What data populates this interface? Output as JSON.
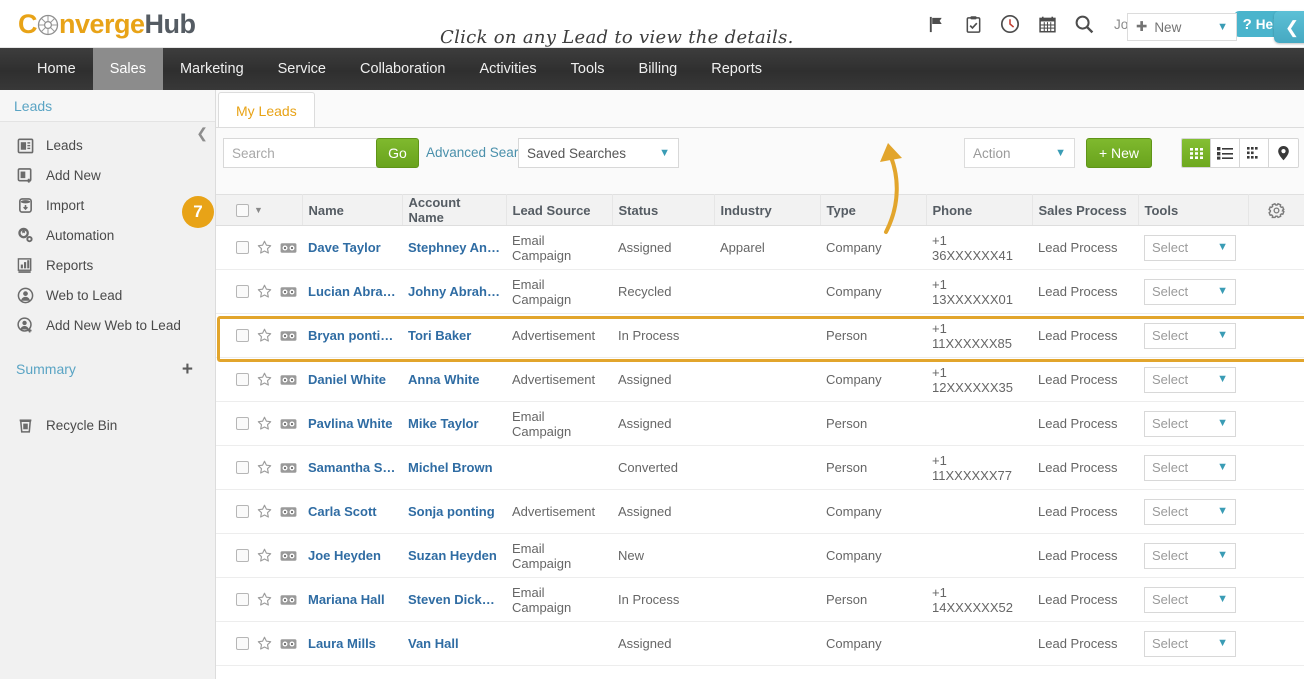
{
  "brand": {
    "name_part1": "C",
    "name_part2": "nverge",
    "name_part3": "Hub",
    "accent_color": "#e8a317",
    "dark_color": "#555c63"
  },
  "topbar": {
    "icons": [
      {
        "name": "flag-icon",
        "label": "Flag"
      },
      {
        "name": "clipboard-check-icon",
        "label": "Tasks"
      },
      {
        "name": "clock-icon",
        "label": "Recent"
      },
      {
        "name": "calendar-icon",
        "label": "Calendar"
      },
      {
        "name": "search-icon",
        "label": "Search"
      }
    ],
    "username": "John Smith",
    "avatar": "user-avatar-icon",
    "help_mark": "?",
    "help_label": "Help",
    "help_color": "#4ab4cc"
  },
  "nav": {
    "items": [
      {
        "label": "Home",
        "active": false
      },
      {
        "label": "Sales",
        "active": true
      },
      {
        "label": "Marketing",
        "active": false
      },
      {
        "label": "Service",
        "active": false
      },
      {
        "label": "Collaboration",
        "active": false
      },
      {
        "label": "Activities",
        "active": false
      },
      {
        "label": "Tools",
        "active": false
      },
      {
        "label": "Billing",
        "active": false
      },
      {
        "label": "Reports",
        "active": false
      }
    ]
  },
  "sidebar": {
    "header": "Leads",
    "collapse_icon": "chevron-left-icon",
    "items": [
      {
        "label": "Leads",
        "icon": "leads-card-icon"
      },
      {
        "label": "Add New",
        "icon": "add-card-icon"
      },
      {
        "label": "Import",
        "icon": "import-database-icon"
      },
      {
        "label": "Automation",
        "icon": "gears-icon"
      },
      {
        "label": "Reports",
        "icon": "bar-chart-icon"
      },
      {
        "label": "Web to Lead",
        "icon": "web-to-lead-icon"
      },
      {
        "label": "Add New Web to Lead",
        "icon": "add-web-to-lead-icon"
      }
    ],
    "summary_label": "Summary",
    "summary_add": "+",
    "recycle": {
      "label": "Recycle Bin",
      "icon": "trash-icon"
    }
  },
  "main": {
    "tab": "My Leads",
    "search": {
      "value": "",
      "placeholder": "Search"
    },
    "go_label": "Go",
    "advanced_search": "Advanced Search",
    "saved_searches": "Saved Searches",
    "action_dropdown": "Action",
    "new_button": "+ New",
    "new_dropdown": {
      "plus": "✚",
      "label": "New"
    },
    "collapse_button_icon": "chevron-left-icon",
    "view_toggles": [
      {
        "name": "grid-view-toggle",
        "icon": "grid-icon",
        "active": true
      },
      {
        "name": "list-view-toggle",
        "icon": "list-icon",
        "active": false
      },
      {
        "name": "split-view-toggle",
        "icon": "split-list-icon",
        "active": false
      },
      {
        "name": "map-view-toggle",
        "icon": "map-pin-icon",
        "active": false
      }
    ]
  },
  "annotation": {
    "text": "Click on any Lead to view the details.",
    "badge_number": "7",
    "color": "#e2a52c"
  },
  "table": {
    "columns": [
      "Name",
      "Account Name",
      "Lead Source",
      "Status",
      "Industry",
      "Type",
      "Phone",
      "Sales Process",
      "Tools"
    ],
    "settings_icon": "gear-icon",
    "select_placeholder": "Select",
    "rows": [
      {
        "name": "Dave Taylor",
        "account": "Stephney Ande…",
        "source": "Email Campaign",
        "status": "Assigned",
        "industry": "Apparel",
        "type": "Company",
        "phone": "+1 36XXXXXX41",
        "process": "Lead Process",
        "tool": "Select",
        "highlighted": true
      },
      {
        "name": "Lucian Abraham",
        "account": "Johny Abraham",
        "source": "Email Campaign",
        "status": "Recycled",
        "industry": "",
        "type": "Company",
        "phone": "+1 13XXXXXX01",
        "process": "Lead Process",
        "tool": "Select",
        "highlighted": false
      },
      {
        "name": "Bryan ponting",
        "account": "Tori Baker",
        "source": "Advertisement",
        "status": "In Process",
        "industry": "",
        "type": "Person",
        "phone": "+1 11XXXXXX85",
        "process": "Lead Process",
        "tool": "Select",
        "highlighted": false
      },
      {
        "name": "Daniel White",
        "account": "Anna White",
        "source": "Advertisement",
        "status": "Assigned",
        "industry": "",
        "type": "Company",
        "phone": "+1 12XXXXXX35",
        "process": "Lead Process",
        "tool": "Select",
        "highlighted": false
      },
      {
        "name": "Pavlina White",
        "account": "Mike Taylor",
        "source": "Email Campaign",
        "status": "Assigned",
        "industry": "",
        "type": "Person",
        "phone": "",
        "process": "Lead Process",
        "tool": "Select",
        "highlighted": false
      },
      {
        "name": "Samantha Scott",
        "account": "Michel Brown",
        "source": "",
        "status": "Converted",
        "industry": "",
        "type": "Person",
        "phone": "+1 11XXXXXX77",
        "process": "Lead Process",
        "tool": "Select",
        "highlighted": false
      },
      {
        "name": "Carla Scott",
        "account": "Sonja ponting",
        "source": "Advertisement",
        "status": "Assigned",
        "industry": "",
        "type": "Company",
        "phone": "",
        "process": "Lead Process",
        "tool": "Select",
        "highlighted": false
      },
      {
        "name": "Joe Heyden",
        "account": "Suzan Heyden",
        "source": "Email Campaign",
        "status": "New",
        "industry": "",
        "type": "Company",
        "phone": "",
        "process": "Lead Process",
        "tool": "Select",
        "highlighted": false
      },
      {
        "name": "Mariana Hall",
        "account": "Steven Dickson",
        "source": "Email Campaign",
        "status": "In Process",
        "industry": "",
        "type": "Person",
        "phone": "+1 14XXXXXX52",
        "process": "Lead Process",
        "tool": "Select",
        "highlighted": false
      },
      {
        "name": "Laura Mills",
        "account": "Van Hall",
        "source": "",
        "status": "Assigned",
        "industry": "",
        "type": "Company",
        "phone": "",
        "process": "Lead Process",
        "tool": "Select",
        "highlighted": false
      }
    ]
  }
}
